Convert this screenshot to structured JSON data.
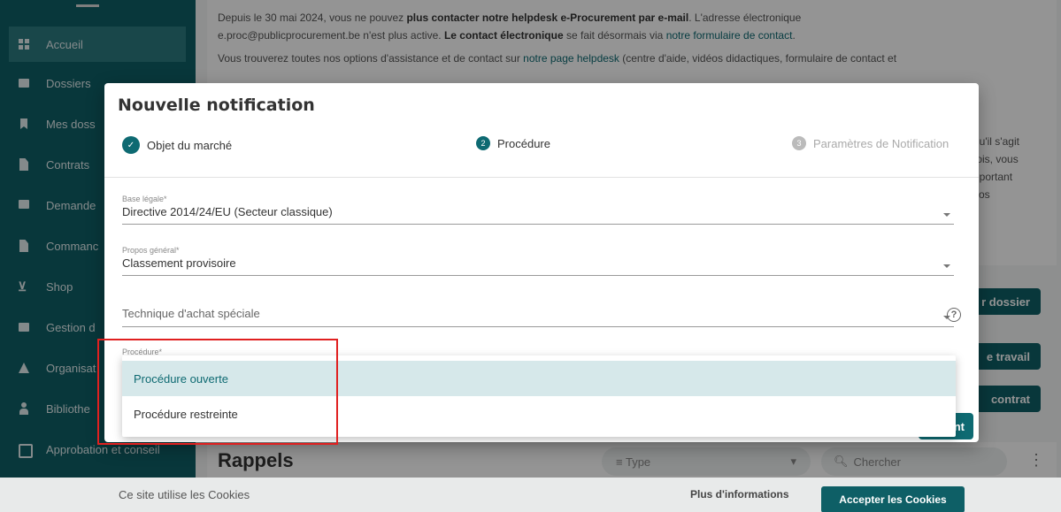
{
  "sidebar": {
    "items": [
      {
        "label": "Accueil",
        "icon": "home-grid-icon"
      },
      {
        "label": "Dossiers",
        "icon": "folder-icon"
      },
      {
        "label": "Mes doss",
        "icon": "bookmark-icon"
      },
      {
        "label": "Contrats",
        "icon": "document-icon"
      },
      {
        "label": "Demande",
        "icon": "chat-icon"
      },
      {
        "label": "Commanc",
        "icon": "order-icon"
      },
      {
        "label": "Shop",
        "icon": "cart-icon"
      },
      {
        "label": "Gestion d",
        "icon": "management-icon"
      },
      {
        "label": "Organisat",
        "icon": "organisation-icon"
      },
      {
        "label": "Bibliothe",
        "icon": "library-icon"
      },
      {
        "label": "Approbation et conseil",
        "icon": "approval-icon"
      }
    ]
  },
  "info": {
    "line1_prefix": "Depuis le 30 mai 2024, vous ne pouvez ",
    "line1_bold": "plus contacter notre helpdesk e-Procurement par e-mail",
    "line1_suffix": ". L'adresse électronique",
    "line2_prefix": "e.proc@publicprocurement.be n'est plus active. ",
    "line2_bold": "Le contact électronique",
    "line2_mid": " se fait désormais via ",
    "line2_link": "notre formulaire de contact",
    "line2_end": ".",
    "line3_prefix": "Vous trouverez toutes nos options d'assistance et de contact sur ",
    "line3_link": "notre page helpdesk",
    "line3_suffix": " (centre d'aide, vidéos didactiques, formulaire de contact et",
    "right_lines": [
      "qu'il s'agit",
      "fois, vous",
      "nportant",
      "vos"
    ]
  },
  "buttons": {
    "dossier": "r dossier",
    "travail": "e travail",
    "contrat": "contrat",
    "next": "nt"
  },
  "rappels": {
    "title": "Rappels",
    "type_placeholder": "Type",
    "search_placeholder": "Chercher"
  },
  "cookie": {
    "text": "Ce site utilise les Cookies",
    "more": "Plus d'informations",
    "accept": "Accepter les Cookies"
  },
  "modal": {
    "title": "Nouvelle notification",
    "steps": [
      {
        "number": "✓",
        "label": "Objet du marché",
        "state": "done"
      },
      {
        "number": "2",
        "label": "Procédure",
        "state": "active"
      },
      {
        "number": "3",
        "label": "Paramètres de Notification",
        "state": "pending"
      }
    ],
    "fields": {
      "base_legale": {
        "label": "Base légale*",
        "value": "Directive 2014/24/EU (Secteur classique)"
      },
      "propos": {
        "label": "Propos général*",
        "value": "Classement provisoire"
      },
      "technique": {
        "placeholder": "Technique d'achat spéciale"
      },
      "procedure": {
        "label": "Procédure*"
      }
    },
    "procedure_options": [
      "Procédure ouverte",
      "Procédure restreinte"
    ],
    "highlighted_option": "Procédure ouverte"
  },
  "colors": {
    "primary": "#0e5f66",
    "highlight": "#d6e8ea",
    "annotation": "#e02020"
  }
}
